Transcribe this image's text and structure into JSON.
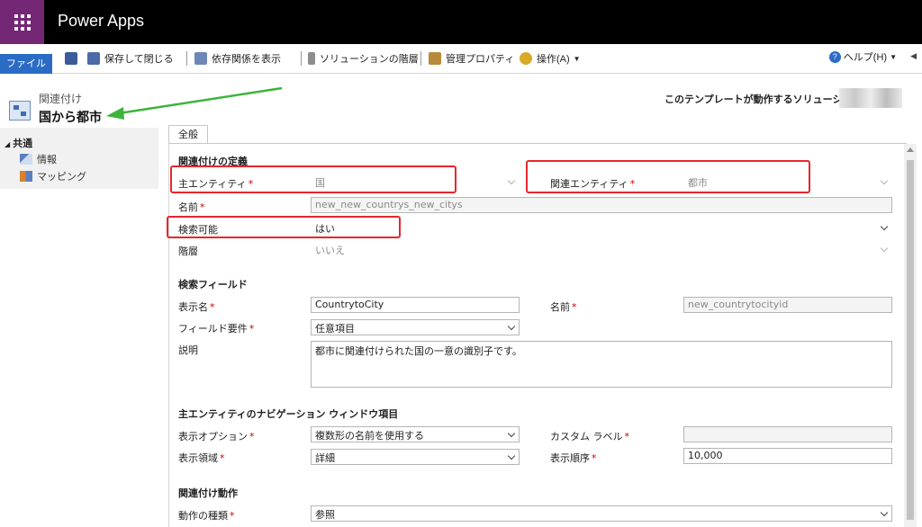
{
  "app": {
    "title": "Power Apps"
  },
  "ribbon": {
    "file": "ファイル",
    "save_close": "保存して閉じる",
    "show_dependencies": "依存関係を表示",
    "solution_layers": "ソリューションの階層",
    "manage_properties": "管理プロパティ",
    "actions": "操作(A)",
    "help": "ヘルプ(H)"
  },
  "header": {
    "record_type": "関連付け",
    "record_name": "国から都市",
    "solution_label": "このテンプレートが動作するソリューション:"
  },
  "nav": {
    "group": "共通",
    "items": [
      "情報",
      "マッピング"
    ]
  },
  "tabs": {
    "general": "全般"
  },
  "sections": {
    "definition": "関連付けの定義",
    "lookup": "検索フィールド",
    "navigation": "主エンティティのナビゲーション ウィンドウ項目",
    "behavior": "関連付け動作"
  },
  "fields": {
    "primary_entity": {
      "label": "主エンティティ",
      "value": "国"
    },
    "related_entity": {
      "label": "関連エンティティ",
      "value": "都市"
    },
    "name": {
      "label": "名前",
      "value": "new_new_countrys_new_citys"
    },
    "searchable": {
      "label": "検索可能",
      "value": "はい"
    },
    "hierarchical": {
      "label": "階層",
      "value": "いいえ"
    },
    "display_name": {
      "label": "表示名",
      "value": "CountrytoCity"
    },
    "lookup_name": {
      "label": "名前",
      "value": "new_countrytocityid"
    },
    "field_requirement": {
      "label": "フィールド要件",
      "value": "任意項目"
    },
    "description": {
      "label": "説明",
      "value": "都市に関連付けられた国の一意の識別子です。"
    },
    "display_option": {
      "label": "表示オプション",
      "value": "複数形の名前を使用する"
    },
    "custom_label": {
      "label": "カスタム ラベル",
      "value": ""
    },
    "display_area": {
      "label": "表示領域",
      "value": "詳細"
    },
    "display_order": {
      "label": "表示順序",
      "value": "10,000"
    },
    "behavior_type": {
      "label": "動作の種類",
      "value": "参照"
    }
  },
  "colors": {
    "brand": "#742774",
    "ribbon_file": "#2a6cc5",
    "required": "#cc0000",
    "highlight": "#e8262d",
    "arrow": "#3cb43c"
  }
}
